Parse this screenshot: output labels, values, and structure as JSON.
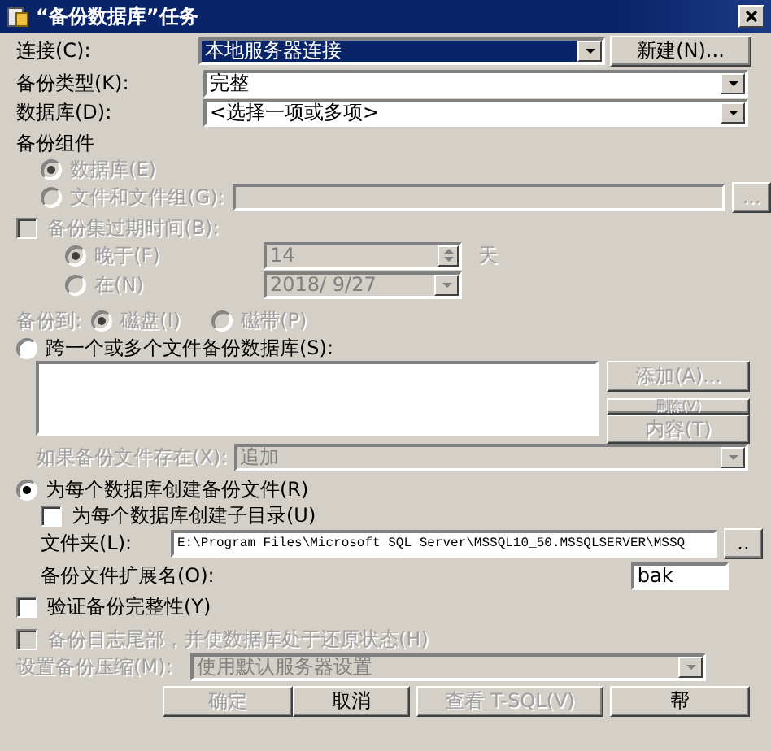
{
  "window": {
    "title": "“备份数据库”任务"
  },
  "connection": {
    "label": "连接(C):",
    "value": "本地服务器连接",
    "button": "新建(N)..."
  },
  "backup_type": {
    "label": "备份类型(K):",
    "value": "完整"
  },
  "database": {
    "label": "数据库(D):",
    "value": "<选择一项或多项>"
  },
  "backup_component": {
    "label": "备份组件",
    "options": [
      {
        "label": "数据库(E)",
        "selected": true,
        "disabled": true
      },
      {
        "label": "文件和文件组(G):",
        "selected": false,
        "disabled": true
      }
    ],
    "browse_button": "..."
  },
  "expiration": {
    "label": "备份集过期时间(B):",
    "checked": false,
    "disabled": true,
    "options": [
      {
        "kind": "spin",
        "label": "晚于(F)",
        "selected": true,
        "value": "14",
        "unit": "天"
      },
      {
        "kind": "date",
        "label": "在(N)",
        "selected": false,
        "value": "2018/ 9/27"
      }
    ]
  },
  "backup_to": {
    "label": "备份到:",
    "disabled": true,
    "options": [
      {
        "label": "磁盘(I)",
        "selected": true
      },
      {
        "label": "磁带(P)",
        "selected": false
      }
    ]
  },
  "span_files": {
    "label": "跨一个或多个文件备份数据库(S):",
    "selected": false,
    "buttons": [
      {
        "label": "添加(A)...",
        "disabled": true
      },
      {
        "label": "删除(V)",
        "disabled": true
      },
      {
        "label": "内容(T)",
        "disabled": true
      }
    ],
    "if_exists": {
      "label": "如果备份文件存在(X):",
      "value": "追加",
      "disabled": true
    }
  },
  "per_database": {
    "label": "为每个数据库创建备份文件(R)",
    "selected": true,
    "subdirectory": {
      "label": "为每个数据库创建子目录(U)",
      "checked": false
    },
    "folder": {
      "label": "文件夹(L):",
      "value": "E:\\Program Files\\Microsoft SQL Server\\MSSQL10_50.MSSQLSERVER\\MSSQ",
      "button": ".."
    },
    "extension": {
      "label": "备份文件扩展名(O):",
      "value": "bak"
    }
  },
  "verify": {
    "label": "验证备份完整性(Y)",
    "checked": false,
    "disabled": false
  },
  "tail_log": {
    "label": "备份日志尾部，并使数据库处于还原状态(H)",
    "checked": false,
    "disabled": true
  },
  "compression": {
    "label": "设置备份压缩(M):",
    "value": "使用默认服务器设置",
    "disabled": true
  },
  "buttons": [
    {
      "label": "确定",
      "disabled": true
    },
    {
      "label": "取消",
      "disabled": false
    },
    {
      "label": "查看 T-SQL(V)",
      "disabled": true
    },
    {
      "label": "帮",
      "disabled": false
    }
  ]
}
